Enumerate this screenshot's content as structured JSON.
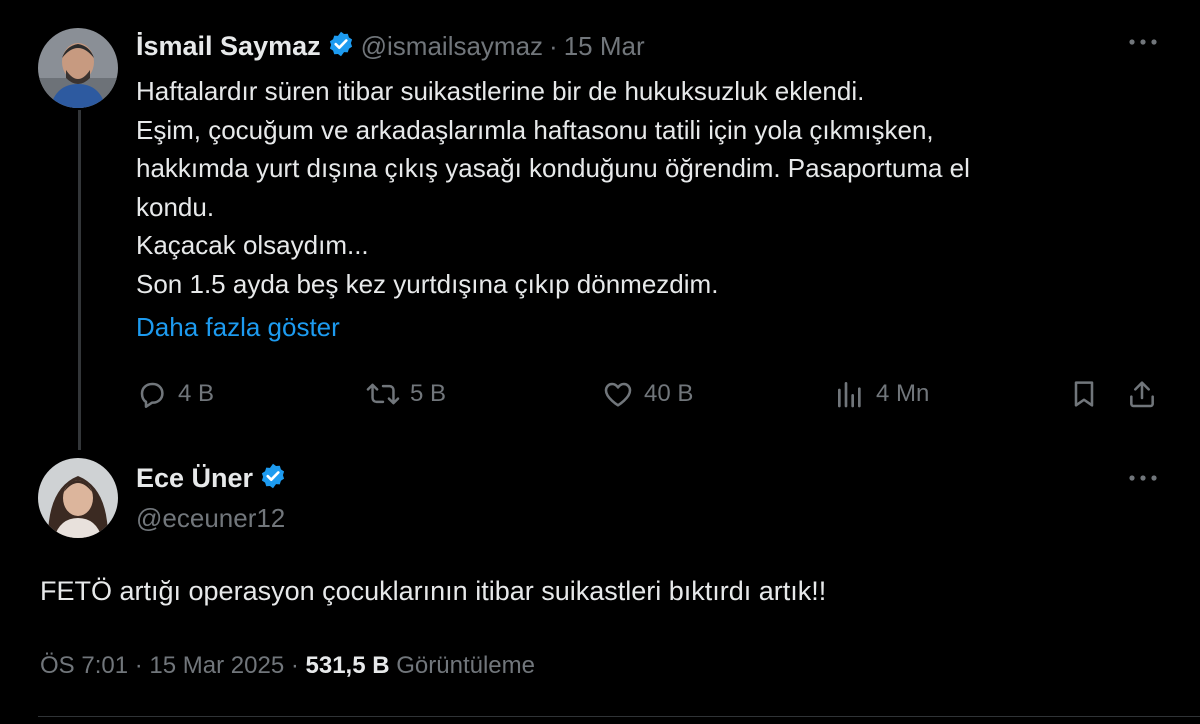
{
  "original_tweet": {
    "author_name": "İsmail Saymaz",
    "handle": "@ismailsaymaz",
    "separator": "·",
    "date": "15 Mar",
    "text_lines": [
      "Haftalardır süren itibar suikastlerine bir de hukuksuzluk eklendi.",
      "Eşim, çocuğum ve arkadaşlarımla haftasonu tatili için yola çıkmışken,",
      "hakkımda yurt dışına çıkış yasağı konduğunu öğrendim. Pasaportuma el",
      "kondu.",
      "Kaçacak olsaydım...",
      "Son 1.5 ayda beş kez yurtdışına çıkıp dönmezdim."
    ],
    "show_more": "Daha fazla göster",
    "actions": {
      "replies": "4 B",
      "reposts": "5 B",
      "likes": "40 B",
      "views": "4 Mn"
    }
  },
  "reply_tweet": {
    "author_name": "Ece Üner",
    "handle": "@eceuner12",
    "text": "FETÖ artığı operasyon çocuklarının itibar suikastleri bıktırdı artık!!",
    "time": "ÖS 7:01",
    "separator1": "·",
    "date": "15 Mar 2025",
    "separator2": "·",
    "view_count": "531,5 B",
    "views_label": "Görüntüleme"
  },
  "icons": {
    "more": "more-horizontal-icon",
    "verified": "verified-badge-icon",
    "reply": "reply-icon",
    "repost": "repost-icon",
    "like": "heart-icon",
    "views": "analytics-icon",
    "bookmark": "bookmark-icon",
    "share": "share-icon"
  },
  "colors": {
    "background": "#000000",
    "text": "#e7e9ea",
    "muted": "#71767b",
    "accent": "#1d9bf0"
  }
}
